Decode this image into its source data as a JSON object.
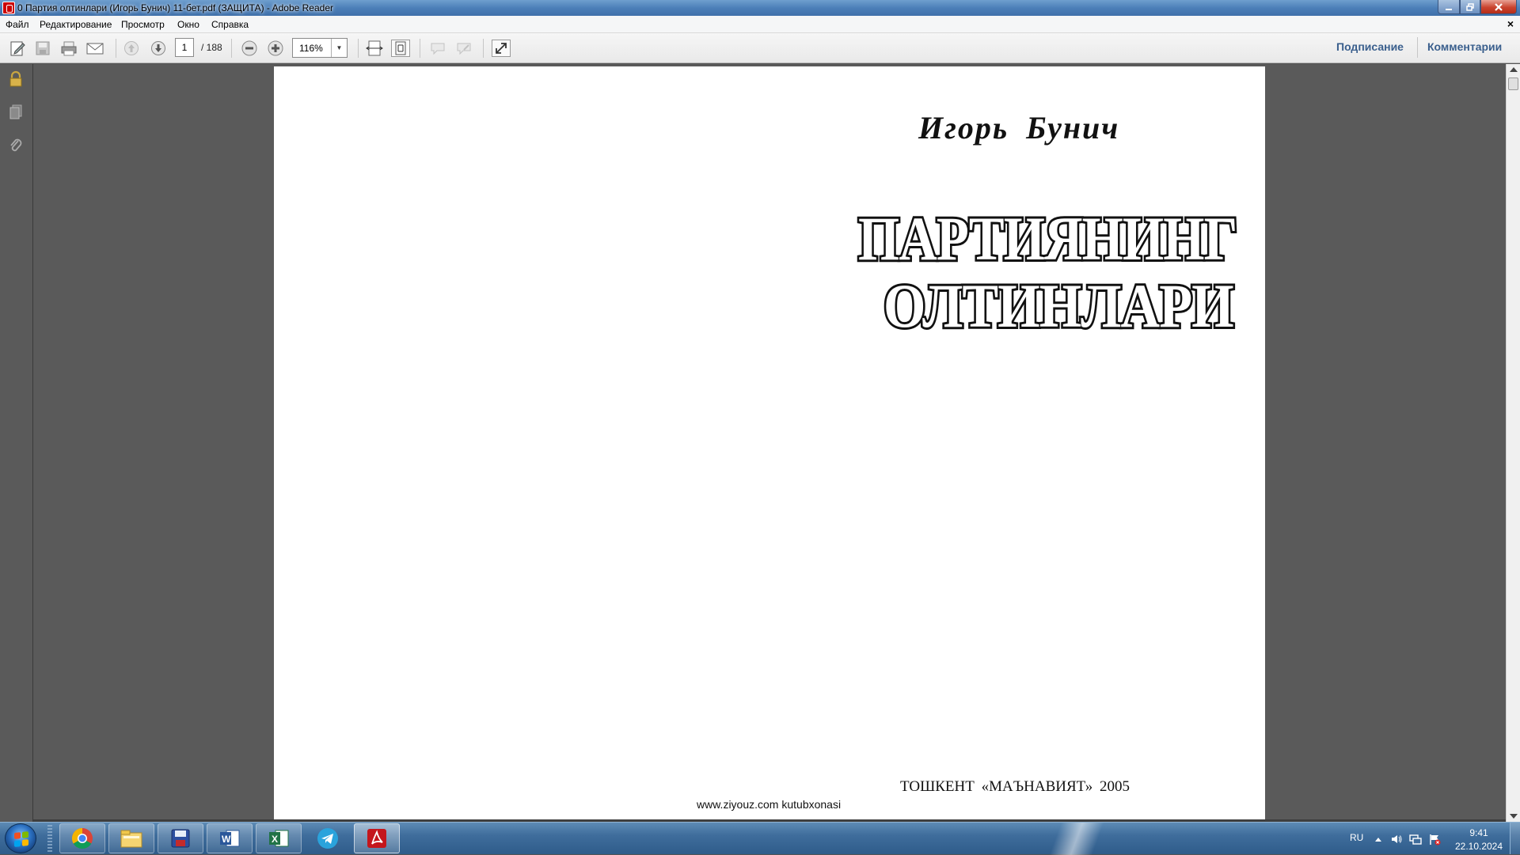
{
  "window": {
    "title": "0 Партия олтинлари (Игорь Бунич) 11-бет.pdf (ЗАЩИТА) - Adobe Reader"
  },
  "menu": {
    "items": [
      "Файл",
      "Редактирование",
      "Просмотр",
      "Окно",
      "Справка"
    ]
  },
  "toolbar": {
    "page_current": "1",
    "page_total": "/ 188",
    "zoom": "116%",
    "sign_label": "Подписание",
    "comments_label": "Комментарии"
  },
  "document": {
    "author": "Игорь Бунич",
    "title_line1": "ПАРТИЯНИНГ",
    "title_line2": "ОЛТИНЛАРИ",
    "publisher": "ТОШКЕНТ «МАЪНАВИЯТ» 2005",
    "footer": "www.ziyouz.com kutubxonasi"
  },
  "taskbar": {
    "apps": [
      "chrome-icon",
      "file-explorer-icon",
      "save-disk-icon",
      "word-icon",
      "excel-icon",
      "telegram-icon",
      "adobe-reader-icon"
    ],
    "active_app": "adobe-reader-icon",
    "language": "RU",
    "time": "9:41",
    "date": "22.10.2024"
  },
  "colors": {
    "title_bar": "#4c7fb8",
    "doc_background": "#5a5a5a",
    "link_blue": "#3a5f8d",
    "taskbar": "#3f6d9c"
  }
}
